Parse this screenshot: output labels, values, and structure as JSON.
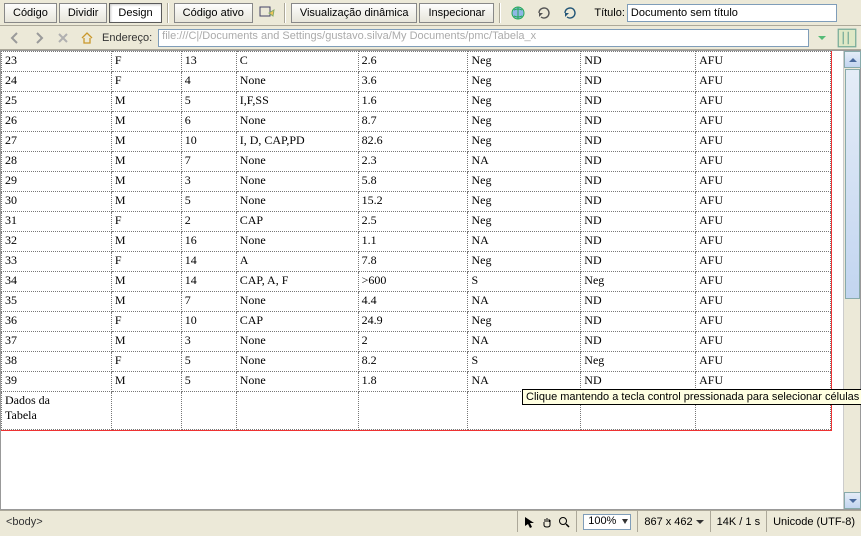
{
  "toolbar": {
    "view_buttons": {
      "code": "Código",
      "split": "Dividir",
      "design": "Design"
    },
    "live_code": "Código ativo",
    "live_view": "Visualização dinâmica",
    "inspect": "Inspecionar",
    "title_label": "Título:",
    "title_value": "Documento sem título"
  },
  "address_bar": {
    "label": "Endereço:",
    "value": "file:///C|/Documents and Settings/gustavo.silva/My Documents/pmc/Tabela_x"
  },
  "table": {
    "rows": [
      [
        "23",
        "F",
        "13",
        "C",
        "2.6",
        "Neg",
        "ND",
        "AFU"
      ],
      [
        "24",
        "F",
        "4",
        "None",
        "3.6",
        "Neg",
        "ND",
        "AFU"
      ],
      [
        "25",
        "M",
        "5",
        "I,F,SS",
        "1.6",
        "Neg",
        "ND",
        "AFU"
      ],
      [
        "26",
        "M",
        "6",
        "None",
        "8.7",
        "Neg",
        "ND",
        "AFU"
      ],
      [
        "27",
        "M",
        "10",
        "I, D, CAP,PD",
        "82.6",
        "Neg",
        "ND",
        "AFU"
      ],
      [
        "28",
        "M",
        "7",
        "None",
        "2.3",
        "NA",
        "ND",
        "AFU"
      ],
      [
        "29",
        "M",
        "3",
        "None",
        "5.8",
        "Neg",
        "ND",
        "AFU"
      ],
      [
        "30",
        "M",
        "5",
        "None",
        "15.2",
        "Neg",
        "ND",
        "AFU"
      ],
      [
        "31",
        "F",
        "2",
        "CAP",
        "2.5",
        "Neg",
        "ND",
        "AFU"
      ],
      [
        "32",
        "M",
        "16",
        "None",
        "1.1",
        "NA",
        "ND",
        "AFU"
      ],
      [
        "33",
        "F",
        "14",
        "A",
        "7.8",
        "Neg",
        "ND",
        "AFU"
      ],
      [
        "34",
        "M",
        "14",
        "CAP, A, F",
        ">600",
        "S",
        "Neg",
        "AFU"
      ],
      [
        "35",
        "M",
        "7",
        "None",
        "4.4",
        "NA",
        "ND",
        "AFU"
      ],
      [
        "36",
        "F",
        "10",
        "CAP",
        "24.9",
        "Neg",
        "ND",
        "AFU"
      ],
      [
        "37",
        "M",
        "3",
        "None",
        "2",
        "NA",
        "ND",
        "AFU"
      ],
      [
        "38",
        "F",
        "5",
        "None",
        "8.2",
        "S",
        "Neg",
        "AFU"
      ],
      [
        "39",
        "M",
        "5",
        "None",
        "1.8",
        "NA",
        "ND",
        "AFU"
      ]
    ],
    "caption": "Dados da\nTabela"
  },
  "tooltip": "Clique mantendo a tecla control pressionada para selecionar células",
  "status": {
    "tag": "<body>",
    "zoom": "100%",
    "dims": "867 x 462",
    "size_time": "14K / 1 s",
    "encoding": "Unicode (UTF-8)"
  }
}
